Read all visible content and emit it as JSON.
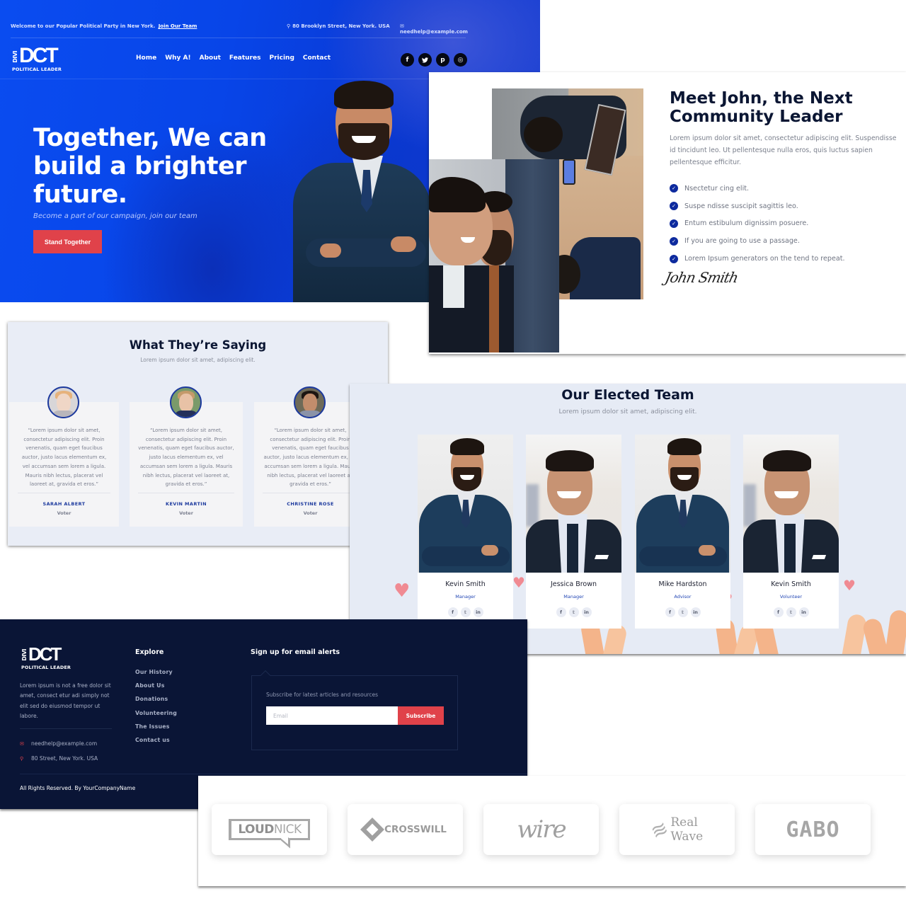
{
  "hero": {
    "topbar": {
      "welcome": "Welcome to our Popular Political Party in New York.",
      "join_link": "Join Our Team",
      "address": "80 Brooklyn Street, New York. USA",
      "email": "needhelp@example.com"
    },
    "logo": {
      "vertical": "DIVI",
      "main": "DCT",
      "tagline": "POLITICAL LEADER"
    },
    "nav": [
      "Home",
      "Why A!",
      "About",
      "Features",
      "Pricing",
      "Contact"
    ],
    "socials": [
      {
        "icon": "facebook-icon",
        "glyph": "f"
      },
      {
        "icon": "twitter-icon",
        "glyph": "t"
      },
      {
        "icon": "pinterest-icon",
        "glyph": "p"
      },
      {
        "icon": "instagram-icon",
        "glyph": "◎"
      }
    ],
    "title": "Together, We can build a brighter future.",
    "subtitle": "Become a part of our campaign, join our team",
    "cta": "Stand Together",
    "accent_color": "#0a45e8",
    "cta_color": "#e0424a"
  },
  "meet": {
    "title": "Meet John, the Next Community Leader",
    "description": "Lorem ipsum dolor sit amet, consectetur adipiscing elit. Suspendisse id tincidunt leo. Ut pellentesque nulla eros, quis luctus sapien pellentesque efficitur.",
    "checklist": [
      "Nsectetur cing elit.",
      "Suspe ndisse suscipit sagittis leo.",
      "Entum estibulum dignissim posuere.",
      "If you are going to use a passage.",
      "Lorem Ipsum generators on the tend to repeat."
    ],
    "signature": "John Smith"
  },
  "testimonials": {
    "title": "What They’re Saying",
    "subtitle": "Lorem ipsum dolor sit amet, adipiscing elit.",
    "items": [
      {
        "quote": "“Lorem ipsum dolor sit amet, consectetur adipiscing elit. Proin venenatis, quam eget faucibus auctor, justo lacus elementum ex, vel accumsan sem lorem a ligula. Mauris nibh lectus, placerat vel laoreet at, gravida et eros.”",
        "name": "SARAH ALBERT",
        "role": "Voter"
      },
      {
        "quote": "“Lorem ipsum dolor sit amet, consectetur adipiscing elit. Proin venenatis, quam eget faucibus auctor, justo lacus elementum ex, vel accumsan sem lorem a ligula. Mauris nibh lectus, placerat vel laoreet at, gravida et eros.”",
        "name": "KEVIN MARTIN",
        "role": "Voter"
      },
      {
        "quote": "“Lorem ipsum dolor sit amet, consectetur adipiscing elit. Proin venenatis, quam eget faucibus auctor, justo lacus elementum ex, vel accumsan sem lorem a ligula. Mauris nibh lectus, placerat vel laoreet at, gravida et eros.”",
        "name": "CHRISTINE ROSE",
        "role": "Voter"
      }
    ]
  },
  "team": {
    "title": "Our Elected Team",
    "subtitle": "Lorem ipsum dolor sit amet, adipiscing elit.",
    "members": [
      {
        "name": "Kevin Smith",
        "role": "Manager"
      },
      {
        "name": "Jessica Brown",
        "role": "Manager"
      },
      {
        "name": "Mike Hardston",
        "role": "Advisor"
      },
      {
        "name": "Kevin Smith",
        "role": "Volunteer"
      }
    ],
    "member_socials": [
      "f",
      "t",
      "in"
    ]
  },
  "footer": {
    "about": "Lorem ipsum is not a free dolor sit amet, consect etur adi simply not elit sed do eiusmod tempor ut labore.",
    "email": "needhelp@example.com",
    "address": "80 Street, New York. USA",
    "explore_title": "Explore",
    "explore_links": [
      "Our History",
      "About Us",
      "Donations",
      "Volunteering",
      "The Issues",
      "Contact us"
    ],
    "signup_title": "Sign up for email alerts",
    "signup_desc": "Subscribe for latest articles and resources",
    "email_placeholder": "Email",
    "subscribe_label": "Subscribe",
    "copyright": "All Rights Reserved. By YourCompanyName",
    "background_color": "#0a1536"
  },
  "partners": {
    "logos": [
      {
        "bold": "LOUD",
        "light": "NICK"
      },
      {
        "text": "CROSSWILL"
      },
      {
        "text": "wire"
      },
      {
        "line1": "Real",
        "line2": "Wave"
      },
      {
        "text": "GABO"
      }
    ]
  }
}
